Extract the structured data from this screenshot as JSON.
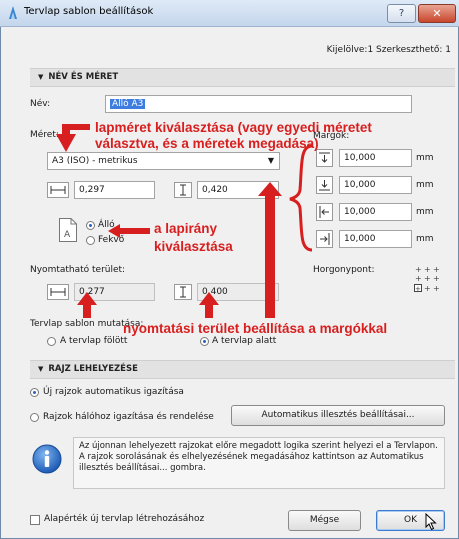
{
  "window": {
    "title": "Tervlap sablon beállítások",
    "help_label": "?",
    "close_label": "✕"
  },
  "selection_info": "Kijelölve:1 Szerkeszthető: 1",
  "section1": {
    "header": "NÉV ÉS MÉRET",
    "name_label": "Név:",
    "name_value": "Álló A3",
    "size_label": "Méret:",
    "size_value": "A3 (ISO) - metrikus",
    "width_value": "0,297",
    "height_value": "0,420",
    "orient_portrait": "Álló",
    "orient_landscape": "Fekvő",
    "margins_label": "Margók:",
    "margins": [
      "10,000",
      "10,000",
      "10,000",
      "10,000"
    ],
    "unit": "mm",
    "printable_label": "Nyomtatható terület:",
    "printable_width": "0,277",
    "printable_height": "0,400",
    "anchor_label": "Horgonypont:",
    "show_label": "Tervlap sablon mutatása:",
    "show_above": "A tervlap fölött",
    "show_below": "A tervlap alatt"
  },
  "section2": {
    "header": "RAJZ LEHELYEZÉSE",
    "option_auto": "Új rajzok automatikus igazítása",
    "option_grid": "Rajzok hálóhoz igazítása és rendelése",
    "auto_button": "Automatikus illesztés beállításai...",
    "info_text": "Az újonnan lehelyezett rajzokat előre megadott logika szerint helyezi el a Tervlapon. A rajzok sorolásának és elhelyezésének megadásához kattintson az Automatikus illesztés beállításai... gombra."
  },
  "footer": {
    "default_checkbox": "Alapérték új tervlap létrehozásához",
    "cancel": "Mégse",
    "ok": "OK"
  },
  "annotations": {
    "size_note": "lapméret kiválasztása (vagy egyedi méretet választva, és a méretek megadása)",
    "orient_note": "a lapirány kiválasztása",
    "printable_note": "nyomtatási terület beállítása a margókkal"
  },
  "colors": {
    "annotation": "#d81f1f",
    "accent": "#3d7de0",
    "section_bg": "#e2e2e2"
  }
}
